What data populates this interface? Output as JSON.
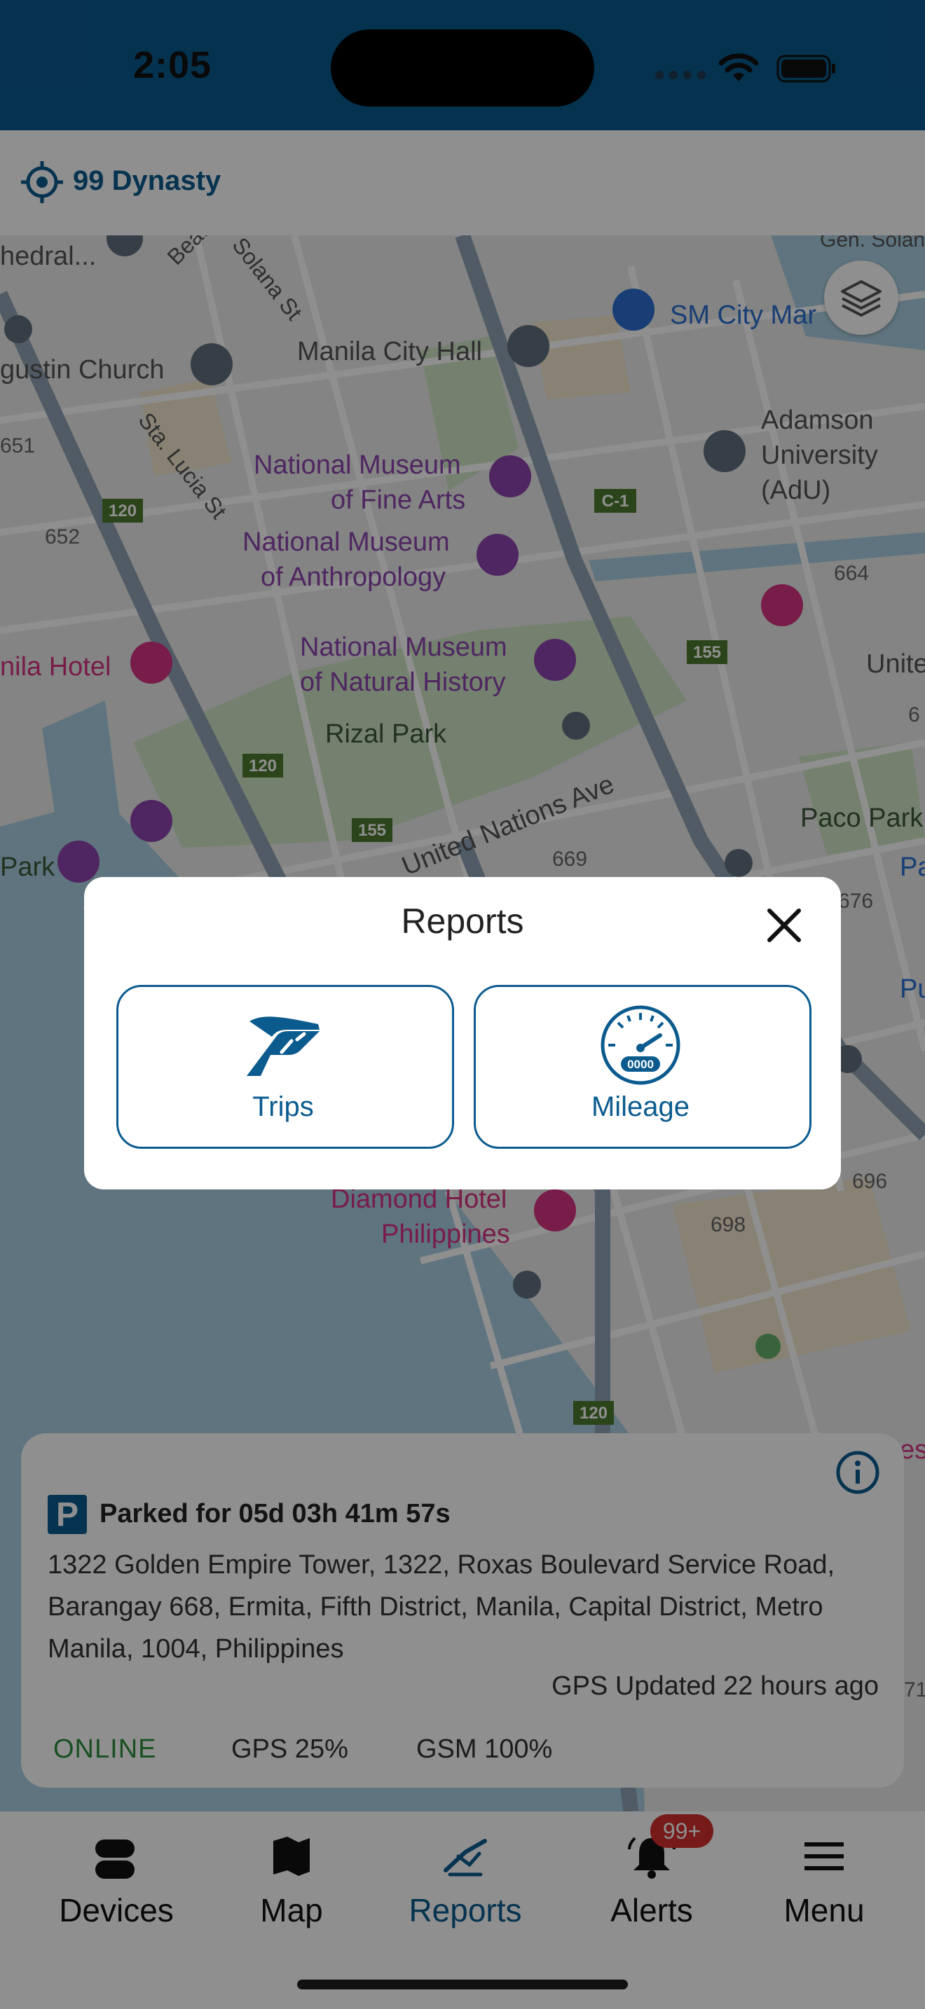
{
  "status_bar": {
    "time": "2:05"
  },
  "header": {
    "device_name": "99 Dynasty"
  },
  "map": {
    "labels": {
      "cathedral": "hedral...",
      "augustin": "gustin Church",
      "manila_city_hall": "Manila City Hall",
      "sm_city": "SM City Mar",
      "gen_solano": "Gen. Solan",
      "beata": "Beata",
      "solana_st": "Solana St",
      "sta_lucia": "Sta. Lucia St",
      "nm_fine_arts_1": "National Museum",
      "nm_fine_arts_2": "of Fine Arts",
      "nm_anthro_1": "National Museum",
      "nm_anthro_2": "of Anthropology",
      "nm_natural_1": "National Museum",
      "nm_natural_2": "of Natural History",
      "rizal_park": "Rizal Park",
      "manila_hotel": "nila Hotel",
      "adamson_1": "Adamson",
      "adamson_2": "University",
      "adamson_3": "(AdU)",
      "paco_park": "Paco Park",
      "un_ave": "United Nations Ave",
      "park": "Park",
      "unite": "Unite",
      "diamond_hotel_1": "Diamond Hotel",
      "diamond_hotel_2": "Philippines",
      "n651": "651",
      "n652": "652",
      "n664": "664",
      "n669": "669",
      "n676": "676",
      "n696": "696",
      "n698": "698",
      "n6": "6",
      "pa": "Pa",
      "pu": "Pu",
      "es": "es",
      "n71": "71",
      "r120a": "120",
      "r120b": "120",
      "r120c": "120",
      "r155a": "155",
      "r155b": "155",
      "c1": "C-1"
    }
  },
  "info_card": {
    "parking_symbol": "P",
    "parked_text": "Parked for 05d 03h 41m 57s",
    "address": "1322 Golden Empire Tower, 1322, Roxas Boulevard Service Road, Barangay 668, Ermita, Fifth District, Manila, Capital District, Metro Manila, 1004, Philippines",
    "gps_updated": "GPS Updated 22 hours ago",
    "online": "ONLINE",
    "gps": "GPS 25%",
    "gsm": "GSM 100%"
  },
  "modal": {
    "title": "Reports",
    "options": [
      {
        "label": "Trips",
        "icon": "road-icon"
      },
      {
        "label": "Mileage",
        "icon": "speedometer-icon",
        "odometer": "0000"
      }
    ]
  },
  "tabs": [
    {
      "label": "Devices",
      "icon": "car-icon"
    },
    {
      "label": "Map",
      "icon": "map-icon"
    },
    {
      "label": "Reports",
      "icon": "reports-icon"
    },
    {
      "label": "Alerts",
      "icon": "bell-icon",
      "badge": "99+"
    },
    {
      "label": "Menu",
      "icon": "hamburger-icon"
    }
  ],
  "colors": {
    "brand": "#0b5b8f",
    "online": "#2f8d3a",
    "badge": "#d32f2f",
    "museum_purple": "#8e44ad",
    "hotel_pink": "#d63384"
  }
}
